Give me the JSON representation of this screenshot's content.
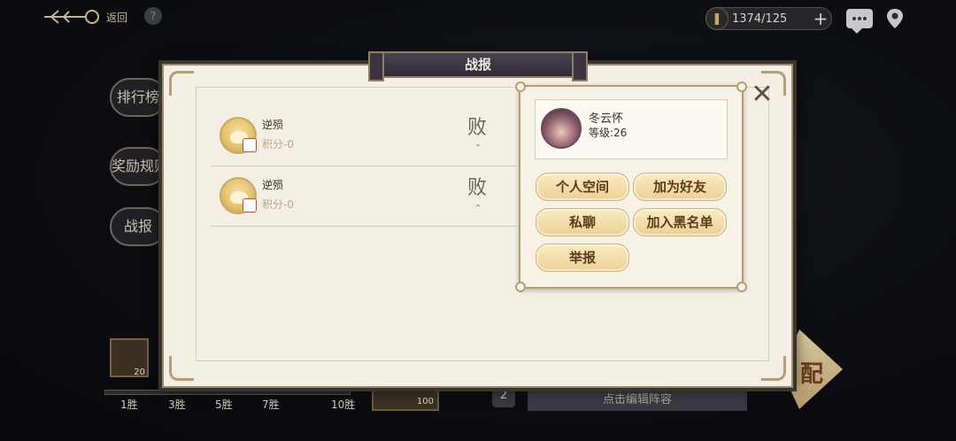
{
  "top_bar": {
    "back_label": "返回",
    "help_label": "?",
    "stamina_value": "1374/125",
    "stamina_plus": "+"
  },
  "side_menu": [
    {
      "label": "排行榜"
    },
    {
      "label": "奖励规则"
    },
    {
      "label": "战报"
    }
  ],
  "bottom": {
    "item_count_1": "20",
    "item_count_2": "100",
    "milestones": [
      "1胜",
      "3胜",
      "5胜",
      "7胜",
      "10胜"
    ],
    "slot_num": "2",
    "edit_lineup": "点击编辑阵容",
    "match_label": "配"
  },
  "dialog": {
    "title": "战报",
    "close_label": "✕",
    "records": [
      {
        "name": "逆殒",
        "score": "积分-0",
        "result": "败",
        "arrow": "⌃"
      },
      {
        "name": "逆殒",
        "score": "积分-0",
        "result": "败",
        "arrow": "⌃"
      }
    ]
  },
  "profile": {
    "name": "冬云怀",
    "level": "等级:26",
    "actions": {
      "space": "个人空间",
      "add_friend": "加为好友",
      "private_chat": "私聊",
      "blacklist": "加入黑名单",
      "report": "举报"
    }
  },
  "colors": {
    "panel": "#f4efe4",
    "button_gold": "#ecd093",
    "title_plate": "#3a3440"
  }
}
